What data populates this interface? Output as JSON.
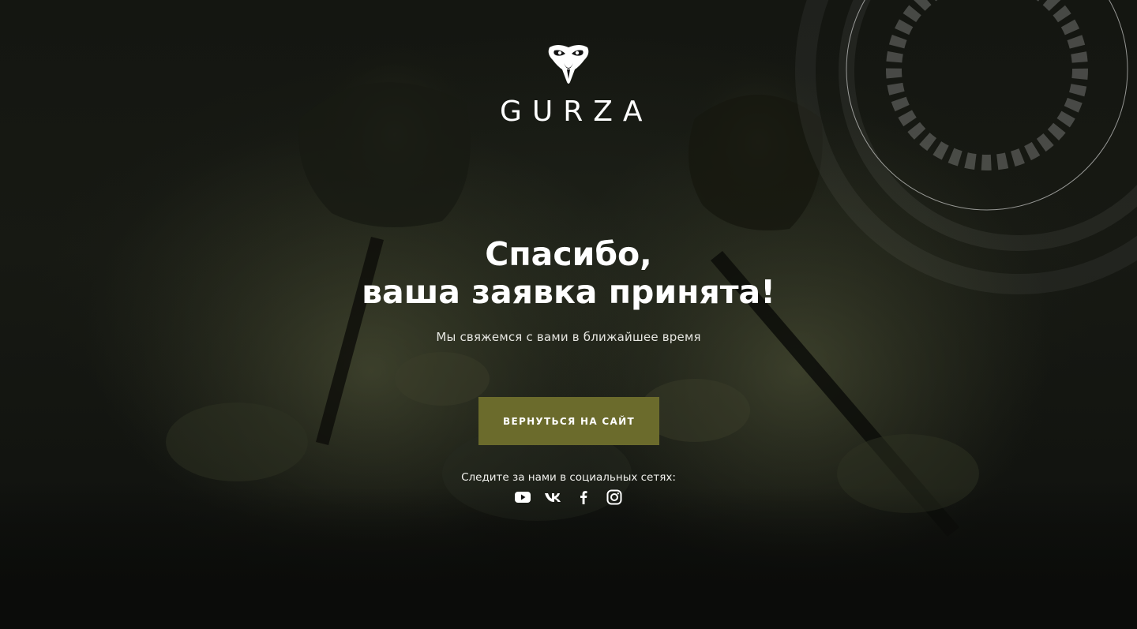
{
  "brand": {
    "logo_icon": "snake-head-icon",
    "name": "GURZA"
  },
  "hero": {
    "title_line1": "Спасибо,",
    "title_line2": "ваша заявка принята!",
    "subtitle": "Мы свяжемся с вами в ближайшее время"
  },
  "actions": {
    "back_button_label": "ВЕРНУТЬСЯ НА САЙТ"
  },
  "social": {
    "label": "Следите за нами в социальных сетях:",
    "links": [
      {
        "icon": "youtube-icon"
      },
      {
        "icon": "vk-icon"
      },
      {
        "icon": "facebook-icon"
      },
      {
        "icon": "instagram-icon"
      }
    ]
  },
  "colors": {
    "background": "#0d0e0b",
    "accent_button": "#6b6b2c",
    "text": "#ffffff"
  }
}
